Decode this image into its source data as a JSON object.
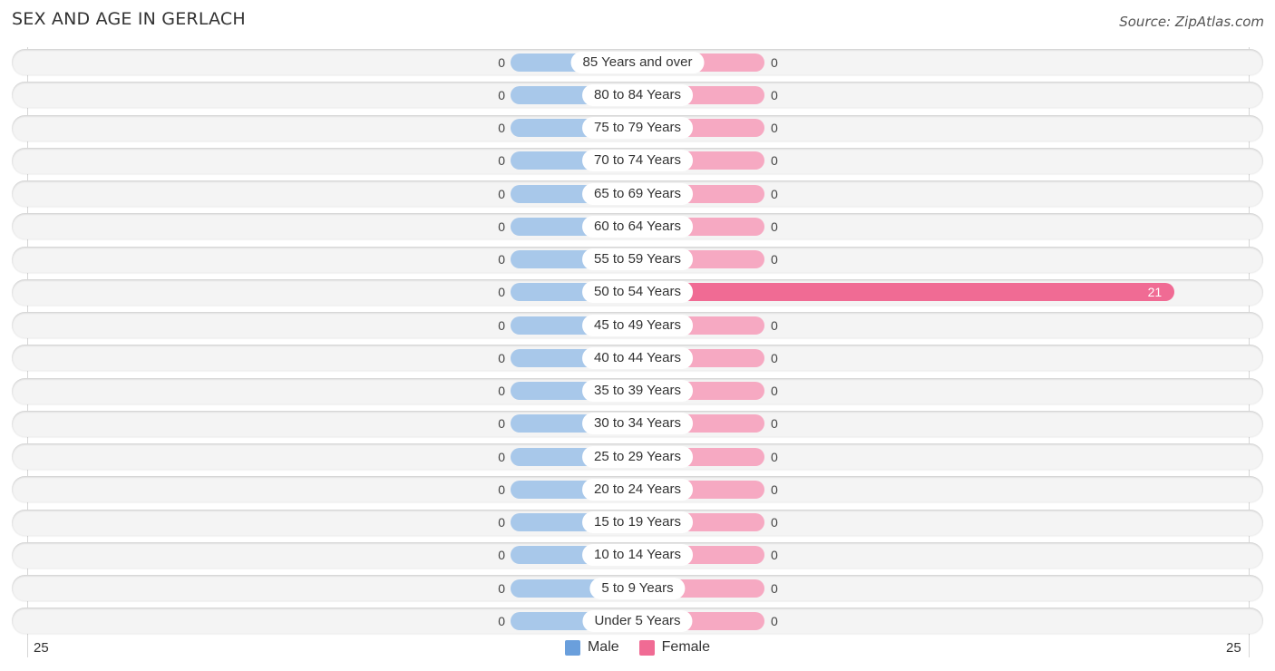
{
  "header": {
    "title": "SEX AND AGE IN GERLACH",
    "source": "Source: ZipAtlas.com"
  },
  "colors": {
    "male": "#a8c8ea",
    "male_legend": "#6a9fdc",
    "female": "#f6a9c2",
    "female_strong": "#f06b94"
  },
  "chart_data": {
    "type": "bar",
    "orientation": "horizontal-diverging",
    "title": "SEX AND AGE IN GERLACH",
    "categories": [
      "85 Years and over",
      "80 to 84 Years",
      "75 to 79 Years",
      "70 to 74 Years",
      "65 to 69 Years",
      "60 to 64 Years",
      "55 to 59 Years",
      "50 to 54 Years",
      "45 to 49 Years",
      "40 to 44 Years",
      "35 to 39 Years",
      "30 to 34 Years",
      "25 to 29 Years",
      "20 to 24 Years",
      "15 to 19 Years",
      "10 to 14 Years",
      "5 to 9 Years",
      "Under 5 Years"
    ],
    "series": [
      {
        "name": "Male",
        "values": [
          0,
          0,
          0,
          0,
          0,
          0,
          0,
          0,
          0,
          0,
          0,
          0,
          0,
          0,
          0,
          0,
          0,
          0
        ]
      },
      {
        "name": "Female",
        "values": [
          0,
          0,
          0,
          0,
          0,
          0,
          0,
          21,
          0,
          0,
          0,
          0,
          0,
          0,
          0,
          0,
          0,
          0
        ]
      }
    ],
    "axis": {
      "left_tick": "25",
      "right_tick": "25",
      "range": [
        25,
        25
      ]
    },
    "legend": {
      "placement": "bottom-center",
      "entries": [
        "Male",
        "Female"
      ]
    },
    "grid": false
  },
  "axis_ticks": {
    "left": "25",
    "right": "25"
  },
  "legend": {
    "male": "Male",
    "female": "Female"
  }
}
